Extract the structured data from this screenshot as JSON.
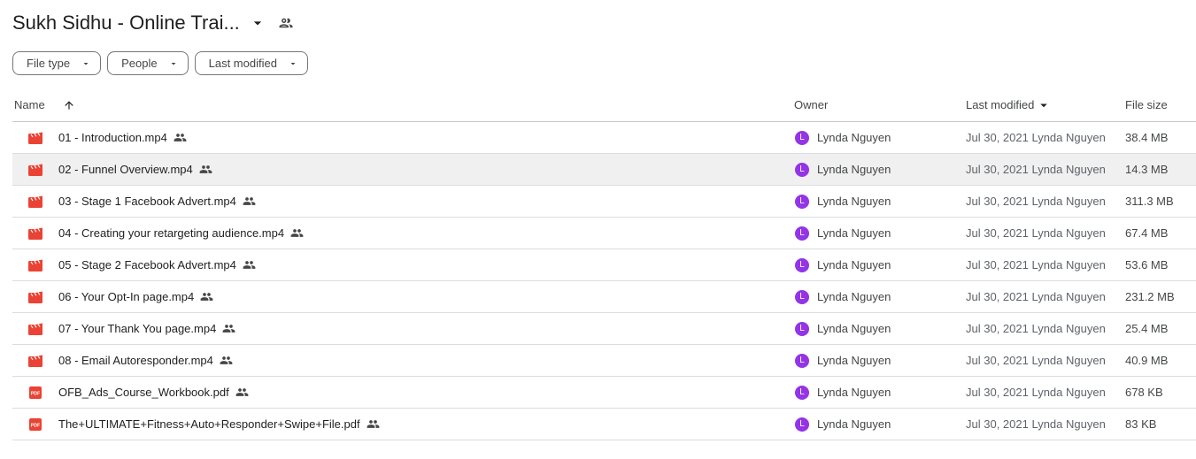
{
  "header": {
    "title": "Sukh Sidhu - Online Trai...",
    "icons": {
      "caret": "arrow-drop-down-icon",
      "shared": "people-icon"
    }
  },
  "filters": [
    {
      "label": "File type"
    },
    {
      "label": "People"
    },
    {
      "label": "Last modified"
    }
  ],
  "columns": {
    "name": "Name",
    "owner": "Owner",
    "last_modified": "Last modified",
    "file_size": "File size",
    "sort_icon": "arrow-upward-icon"
  },
  "rows": [
    {
      "name": "01 - Introduction.mp4",
      "type": "video",
      "owner": "Lynda Nguyen",
      "owner_initial": "L",
      "modified": "Jul 30, 2021 Lynda Nguyen",
      "size": "38.4 MB"
    },
    {
      "name": "02 - Funnel Overview.mp4",
      "type": "video",
      "owner": "Lynda Nguyen",
      "owner_initial": "L",
      "modified": "Jul 30, 2021 Lynda Nguyen",
      "size": "14.3 MB"
    },
    {
      "name": "03 - Stage 1 Facebook Advert.mp4",
      "type": "video",
      "owner": "Lynda Nguyen",
      "owner_initial": "L",
      "modified": "Jul 30, 2021 Lynda Nguyen",
      "size": "311.3 MB"
    },
    {
      "name": "04 - Creating your retargeting audience.mp4",
      "type": "video",
      "owner": "Lynda Nguyen",
      "owner_initial": "L",
      "modified": "Jul 30, 2021 Lynda Nguyen",
      "size": "67.4 MB"
    },
    {
      "name": "05 - Stage 2 Facebook Advert.mp4",
      "type": "video",
      "owner": "Lynda Nguyen",
      "owner_initial": "L",
      "modified": "Jul 30, 2021 Lynda Nguyen",
      "size": "53.6 MB"
    },
    {
      "name": "06 - Your Opt-In page.mp4",
      "type": "video",
      "owner": "Lynda Nguyen",
      "owner_initial": "L",
      "modified": "Jul 30, 2021 Lynda Nguyen",
      "size": "231.2 MB"
    },
    {
      "name": "07 - Your Thank You page.mp4",
      "type": "video",
      "owner": "Lynda Nguyen",
      "owner_initial": "L",
      "modified": "Jul 30, 2021 Lynda Nguyen",
      "size": "25.4 MB"
    },
    {
      "name": "08 - Email Autoresponder.mp4",
      "type": "video",
      "owner": "Lynda Nguyen",
      "owner_initial": "L",
      "modified": "Jul 30, 2021 Lynda Nguyen",
      "size": "40.9 MB"
    },
    {
      "name": "OFB_Ads_Course_Workbook.pdf",
      "type": "pdf",
      "owner": "Lynda Nguyen",
      "owner_initial": "L",
      "modified": "Jul 30, 2021 Lynda Nguyen",
      "size": "678 KB"
    },
    {
      "name": "The+ULTIMATE+Fitness+Auto+Responder+Swipe+File.pdf",
      "type": "pdf",
      "owner": "Lynda Nguyen",
      "owner_initial": "L",
      "modified": "Jul 30, 2021 Lynda Nguyen",
      "size": "83 KB"
    }
  ],
  "colors": {
    "file_icon": "#ea4335",
    "avatar": "#9334e6",
    "hover_row": "#f0f0f0",
    "icon_gray": "#444746"
  }
}
